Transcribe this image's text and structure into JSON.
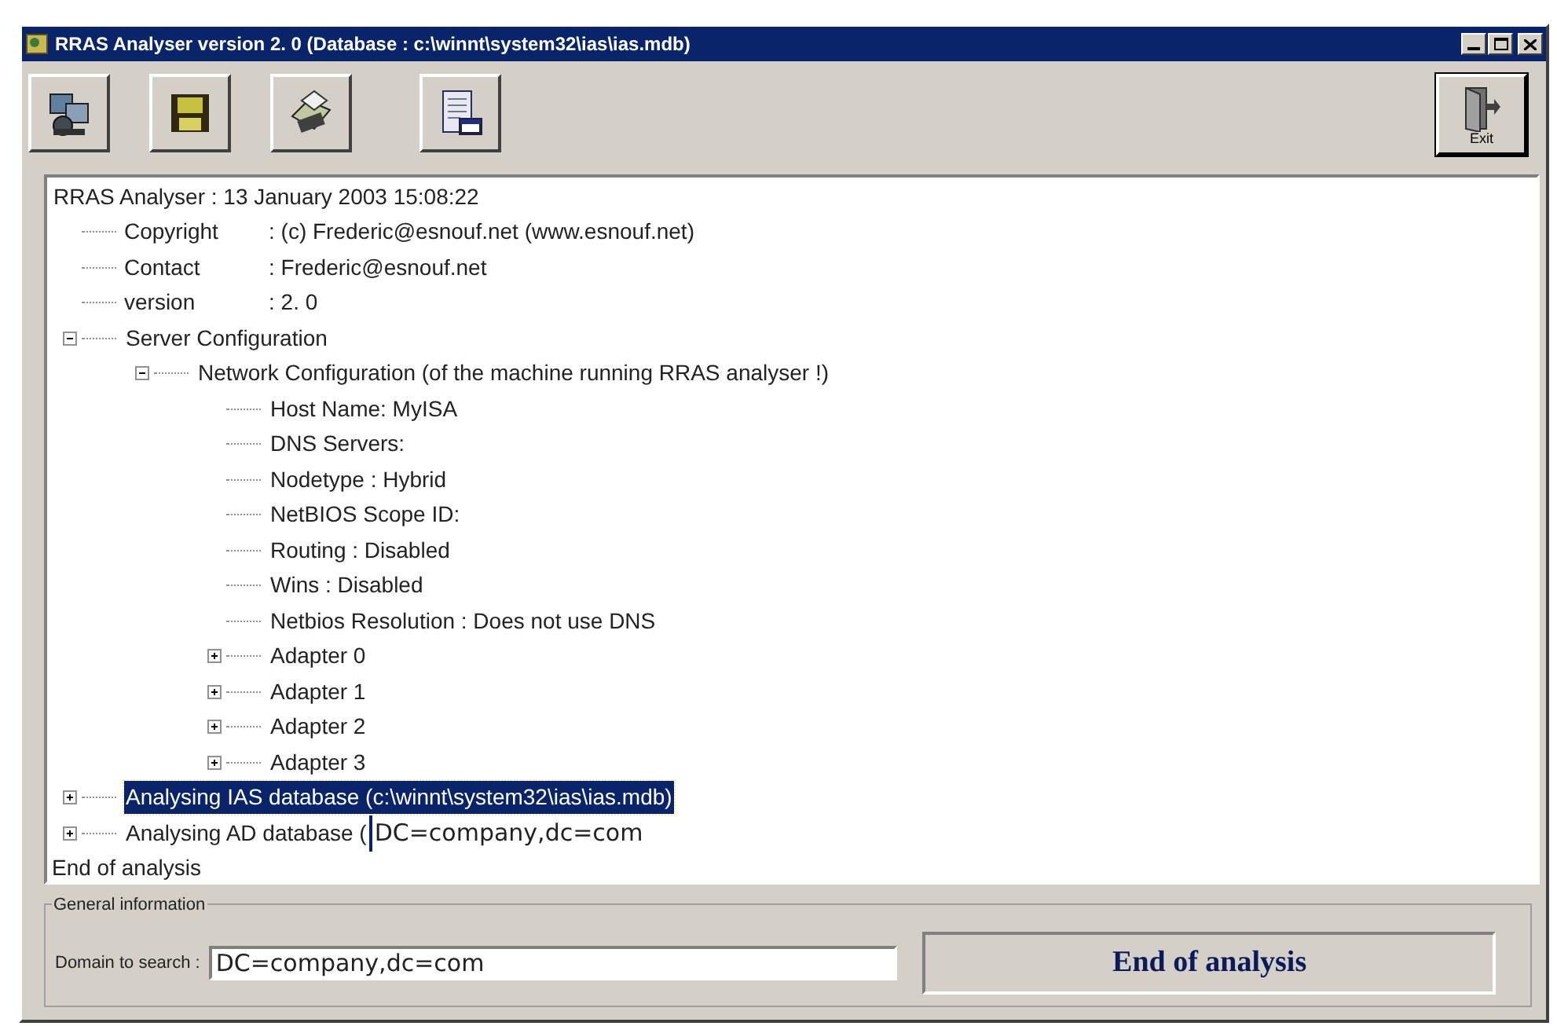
{
  "window": {
    "title": "RRAS Analyser version  2. 0 (Database : c:\\winnt\\system32\\ias\\ias.mdb)"
  },
  "toolbar": {
    "buttons": [
      {
        "kind": "network"
      },
      {
        "kind": "save"
      },
      {
        "kind": "print"
      },
      {
        "kind": "report"
      }
    ],
    "exit_button": {
      "label": "Exit"
    }
  },
  "tree": {
    "label": "RRAS Analyser : 13 January 2003 15:08:22",
    "selected": false,
    "children": [
      {
        "kind": "field",
        "label": "Copyright",
        "value": ": (c) Frederic@esnouf.net (www.esnouf.net)",
        "selected": false
      },
      {
        "kind": "field",
        "label": "Contact",
        "value": ": Frederic@esnouf.net",
        "selected": false
      },
      {
        "kind": "field",
        "label": "version",
        "value": ":  2. 0",
        "selected": false
      },
      {
        "label": "Server Configuration",
        "expanded": true,
        "selected": false,
        "children": [
          {
            "label": "Network Configuration (of the machine running RRAS analyser !)",
            "expanded": true,
            "selected": false,
            "children": [
              {
                "label": "Host Name:  MyISA",
                "selected": false
              },
              {
                "label": "DNS Servers:",
                "selected": false
              },
              {
                "label": "Nodetype : Hybrid",
                "selected": false
              },
              {
                "label": "NetBIOS Scope ID:",
                "selected": false
              },
              {
                "label": "Routing : Disabled",
                "selected": false
              },
              {
                "label": "Wins : Disabled",
                "selected": false
              },
              {
                "label": "Netbios Resolution :  Does not use DNS",
                "selected": false
              },
              {
                "label": "Adapter 0",
                "expanded": false,
                "selected": false
              },
              {
                "label": "Adapter 1",
                "expanded": false,
                "selected": false
              },
              {
                "label": "Adapter 2",
                "expanded": false,
                "selected": false
              },
              {
                "label": "Adapter 3",
                "expanded": false,
                "selected": false
              }
            ]
          }
        ]
      },
      {
        "label": "Analysing IAS database (c:\\winnt\\system32\\ias\\ias.mdb)",
        "expanded": false,
        "selected": true
      },
      {
        "label": "Analysing AD database (",
        "edit_value": "DC=company,dc=com",
        "expanded": false,
        "selected": false
      }
    ]
  },
  "tree_footer": "End of analysis",
  "general_information": {
    "title": "General information",
    "domain_label": "Domain to search :",
    "domain_value": "DC=company,dc=com",
    "status": "End of analysis"
  }
}
